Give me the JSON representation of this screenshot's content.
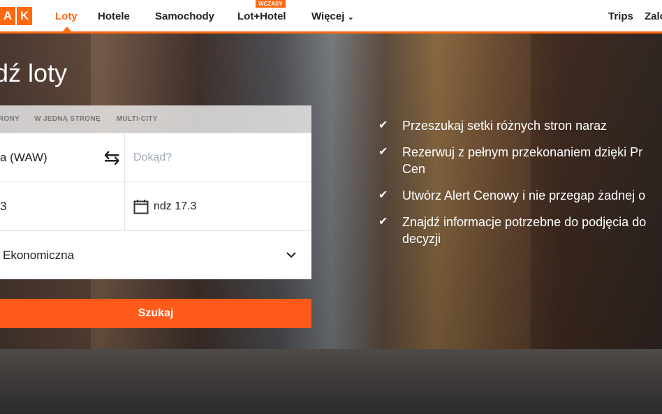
{
  "nav": {
    "logo": [
      "A",
      "K"
    ],
    "items": [
      "Loty",
      "Hotele",
      "Samochody",
      "Lot+Hotel",
      "Więcej"
    ],
    "badge": "WCZASY",
    "right": [
      "Trips",
      "Zalo"
    ]
  },
  "hero": {
    "title": "dź loty"
  },
  "form": {
    "tabs": [
      "RONY",
      "W JEDNĄ STRONĘ",
      "MULTI-CITY"
    ],
    "origin": "a (WAW)",
    "destination_placeholder": "Dokąd?",
    "depart": "3",
    "return": "ndz 17.3",
    "cabin": "Ekonomiczna",
    "search": "Szukaj"
  },
  "benefits": [
    {
      "lines": [
        "Przeszukaj setki różnych stron naraz"
      ]
    },
    {
      "lines": [
        "Rezerwuj z pełnym przekonaniem dzięki Pr",
        "Cen"
      ]
    },
    {
      "lines": [
        "Utwórz Alert Cenowy i nie przegap żadnej o"
      ]
    },
    {
      "lines": [
        "Znajdź informacje potrzebne do podjęcia do",
        "decyzji"
      ]
    }
  ],
  "colors": {
    "accent": "#ff690f"
  }
}
